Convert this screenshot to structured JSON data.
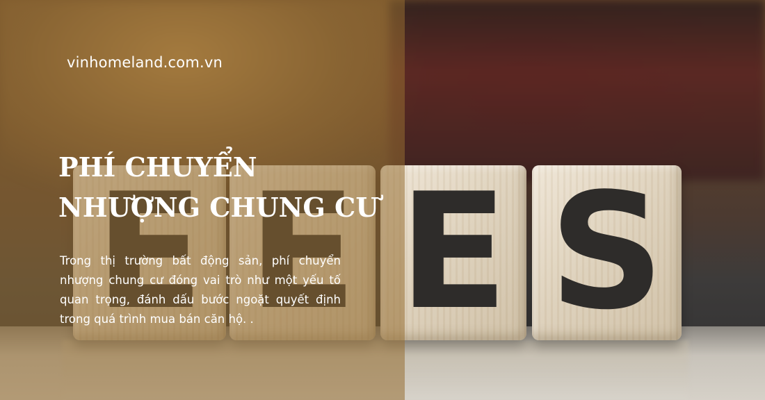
{
  "site": "vinhomeland.com.vn",
  "title_lines": [
    "PHÍ CHUYỂN",
    "NHƯỢNG CHUNG CƯ"
  ],
  "description": "Trong thị trường bất động sản, phí chuyển nhượng chung cư đóng vai trò như một yếu tố quan trọng, đánh dấu bước ngoặt quyết định trong quá trình mua bán căn hộ. .",
  "blocks": [
    "E",
    "E",
    "E",
    "S"
  ],
  "colors": {
    "overlay": "#96703280",
    "text": "#ffffff"
  }
}
